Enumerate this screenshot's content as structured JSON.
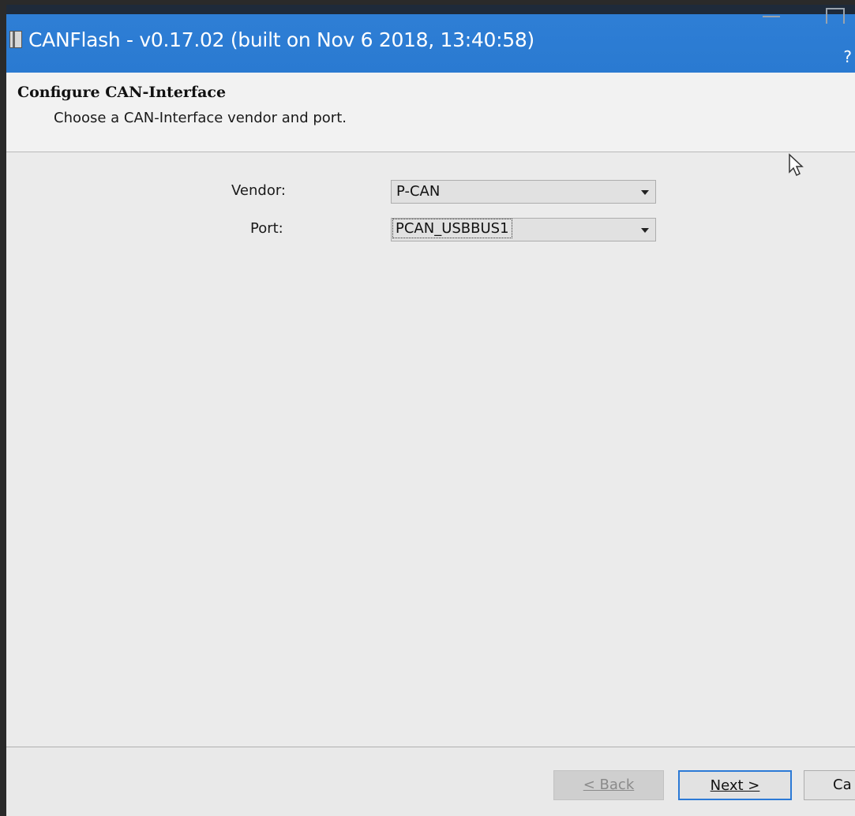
{
  "window": {
    "title": "CANFlash - v0.17.02  (built on Nov  6 2018, 13:40:58)",
    "help_glyph": "?"
  },
  "header": {
    "title": "Configure CAN-Interface",
    "subtitle": "Choose a CAN-Interface vendor and port."
  },
  "form": {
    "vendor": {
      "label": "Vendor:",
      "value": "P-CAN"
    },
    "port": {
      "label": "Port:",
      "value": "PCAN_USBBUS1"
    }
  },
  "footer": {
    "back_label": "< Back",
    "next_label": "Next >",
    "cancel_label": "Ca"
  },
  "colors": {
    "titlebar": "#2a7ad1",
    "focus_border": "#2c7ad6"
  },
  "icons": [
    "app-icon",
    "minimize-icon",
    "maximize-icon",
    "chevron-down-icon",
    "mouse-cursor-icon"
  ]
}
